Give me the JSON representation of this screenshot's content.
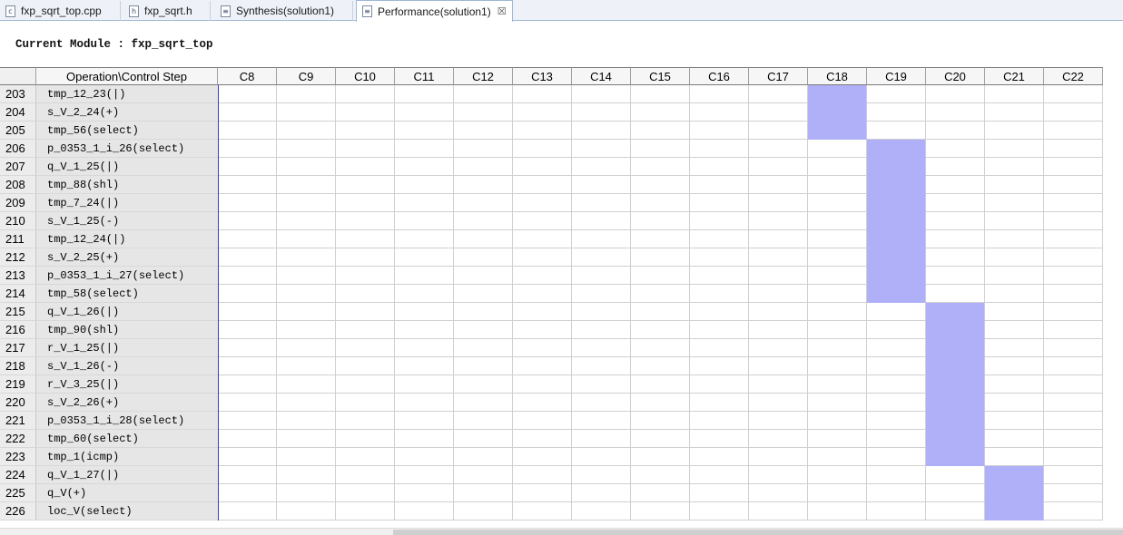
{
  "tabs": [
    {
      "label": "fxp_sqrt_top.cpp",
      "icon": "c"
    },
    {
      "label": "fxp_sqrt.h",
      "icon": "h"
    },
    {
      "label": "Synthesis(solution1)",
      "icon": "doc"
    },
    {
      "label": "Performance(solution1)",
      "icon": "doc",
      "close": "☒"
    }
  ],
  "module": {
    "text": "Current Module : fxp_sqrt_top"
  },
  "table": {
    "op_header": "Operation\\Control Step",
    "steps": [
      "C8",
      "C9",
      "C10",
      "C11",
      "C12",
      "C13",
      "C14",
      "C15",
      "C16",
      "C17",
      "C18",
      "C19",
      "C20",
      "C21",
      "C22"
    ],
    "rows": [
      {
        "num": "203",
        "op": "tmp_12_23(|)",
        "step": "C18"
      },
      {
        "num": "204",
        "op": "s_V_2_24(+)",
        "step": "C18"
      },
      {
        "num": "205",
        "op": "tmp_56(select)",
        "step": "C18"
      },
      {
        "num": "206",
        "op": "p_0353_1_i_26(select)",
        "step": "C19"
      },
      {
        "num": "207",
        "op": "q_V_1_25(|)",
        "step": "C19"
      },
      {
        "num": "208",
        "op": "tmp_88(shl)",
        "step": "C19"
      },
      {
        "num": "209",
        "op": "tmp_7_24(|)",
        "step": "C19"
      },
      {
        "num": "210",
        "op": "s_V_1_25(-)",
        "step": "C19"
      },
      {
        "num": "211",
        "op": "tmp_12_24(|)",
        "step": "C19"
      },
      {
        "num": "212",
        "op": "s_V_2_25(+)",
        "step": "C19"
      },
      {
        "num": "213",
        "op": "p_0353_1_i_27(select)",
        "step": "C19"
      },
      {
        "num": "214",
        "op": "tmp_58(select)",
        "step": "C19"
      },
      {
        "num": "215",
        "op": "q_V_1_26(|)",
        "step": "C20"
      },
      {
        "num": "216",
        "op": "tmp_90(shl)",
        "step": "C20"
      },
      {
        "num": "217",
        "op": "r_V_1_25(|)",
        "step": "C20"
      },
      {
        "num": "218",
        "op": "s_V_1_26(-)",
        "step": "C20"
      },
      {
        "num": "219",
        "op": "r_V_3_25(|)",
        "step": "C20"
      },
      {
        "num": "220",
        "op": "s_V_2_26(+)",
        "step": "C20"
      },
      {
        "num": "221",
        "op": "p_0353_1_i_28(select)",
        "step": "C20"
      },
      {
        "num": "222",
        "op": "tmp_60(select)",
        "step": "C20"
      },
      {
        "num": "223",
        "op": "tmp_1(icmp)",
        "step": "C20"
      },
      {
        "num": "224",
        "op": "q_V_1_27(|)",
        "step": "C21"
      },
      {
        "num": "225",
        "op": "q_V(+)",
        "step": "C21"
      },
      {
        "num": "226",
        "op": "loc_V(select)",
        "step": "C21"
      }
    ]
  },
  "colors": {
    "scheduled_cell": "#b0b0f8",
    "row_header_bg": "#e6e6e6",
    "divider": "#3040c0"
  }
}
